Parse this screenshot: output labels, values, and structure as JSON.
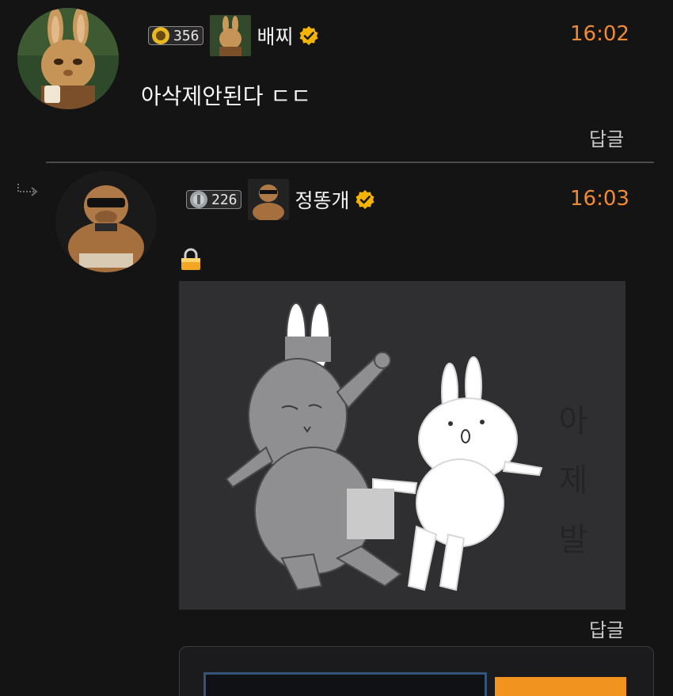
{
  "comments": [
    {
      "level": "356",
      "nickname": "배찌",
      "time": "16:02",
      "text": "아삭제안된다 ㄷㄷ",
      "reply_label": "답글",
      "avatar_icon": "rabbit-avatar",
      "level_icon": "sunflower-icon"
    },
    {
      "level": "226",
      "nickname": "정똥개",
      "time": "16:03",
      "reply_label": "답글",
      "avatar_icon": "bulldog-avatar",
      "level_icon": "silver-coin-icon",
      "sticker_text": [
        "아",
        "제",
        "발"
      ]
    }
  ],
  "colors": {
    "background": "#141415",
    "time": "#f08a35",
    "verified": "#f5b400",
    "divider": "#4a4a4c"
  }
}
